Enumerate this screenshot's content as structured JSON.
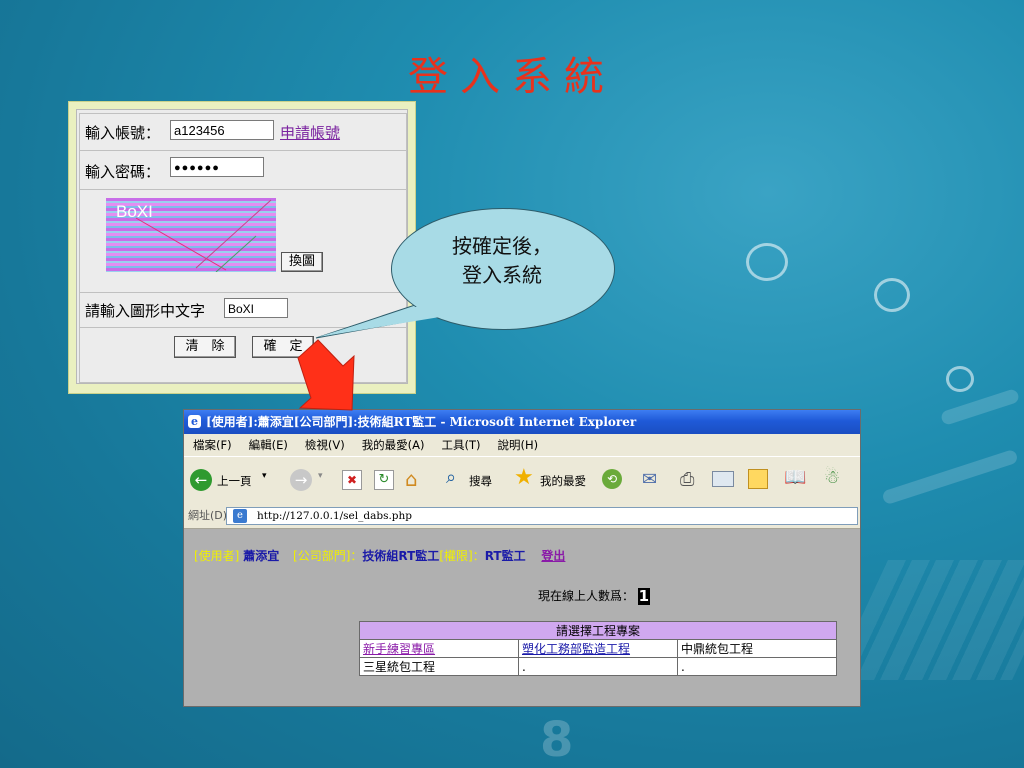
{
  "slide": {
    "title": "登入系統"
  },
  "login": {
    "account_label": "輸入帳號：",
    "account_value": "a123456",
    "apply_link": "申請帳號",
    "password_label": "輸入密碼：",
    "password_value": "●●●●●●",
    "captcha_text": "BoXI",
    "change_image_button": "換圖",
    "captcha_prompt": "請輸入圖形中文字",
    "captcha_input_value": "BoXI",
    "clear_button": "清　除",
    "confirm_button": "確　定"
  },
  "callout": {
    "line1": "按確定後，",
    "line2": "登入系統"
  },
  "browser": {
    "window_title": "[使用者]:蕭添宜[公司部門]:技術組RT監工 - Microsoft Internet Explorer",
    "menu": [
      "檔案(F)",
      "編輯(E)",
      "檢視(V)",
      "我的最愛(A)",
      "工具(T)",
      "說明(H)"
    ],
    "toolbar": {
      "back_label": "上一頁",
      "search_label": "搜尋",
      "favorites_label": "我的最愛"
    },
    "address_label": "網址(D)",
    "address_url": "http://127.0.0.1/sel_dabs.php",
    "user_info": {
      "user_label": "[使用者]",
      "user_name": "蕭添宜",
      "dept_label": "[公司部門]：",
      "dept_name": "技術組RT監工",
      "role_label": "[權限]：",
      "role_name": "RT監工",
      "logout": "登出"
    },
    "online_label": "現在線上人數爲：",
    "online_count": "1",
    "table_header": "請選擇工程專案",
    "projects": [
      [
        "新手練習專區",
        "塑化工務部監造工程",
        "中鼎統包工程"
      ],
      [
        "三星統包工程",
        ".",
        "."
      ]
    ]
  },
  "colors": {
    "title_red": "#e8321c",
    "link_purple": "#7b24a0",
    "user_yellow": "#f0f000",
    "user_blue": "#1a1aa8",
    "table_header_bg": "#d0a8f0"
  }
}
